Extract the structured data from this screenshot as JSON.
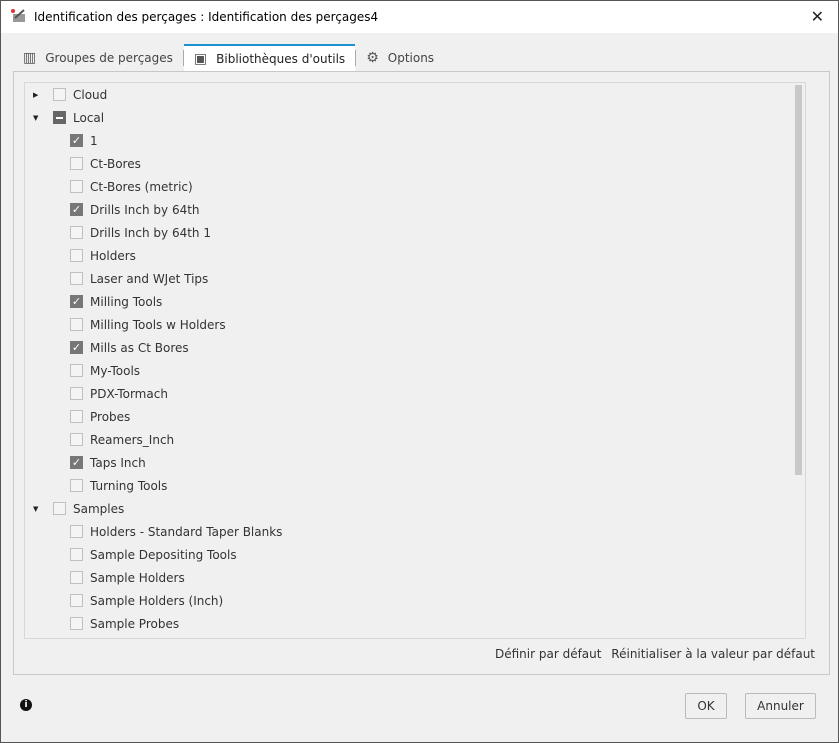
{
  "window": {
    "title": "Identification des perçages : Identification des perçages4",
    "close": "✕"
  },
  "tabs": [
    {
      "label": "Groupes de perçages",
      "icon": "drill-groups-icon"
    },
    {
      "label": "Bibliothèques d'outils",
      "icon": "tool-library-icon",
      "active": true
    },
    {
      "label": "Options",
      "icon": "gear-icon"
    }
  ],
  "tree": [
    {
      "label": "Cloud",
      "level": 0,
      "expander": "collapsed",
      "state": "unchecked"
    },
    {
      "label": "Local",
      "level": 0,
      "expander": "expanded",
      "state": "partial"
    },
    {
      "label": "1",
      "level": 1,
      "state": "checked"
    },
    {
      "label": "Ct-Bores",
      "level": 1,
      "state": "unchecked"
    },
    {
      "label": "Ct-Bores (metric)",
      "level": 1,
      "state": "unchecked"
    },
    {
      "label": "Drills Inch by 64th",
      "level": 1,
      "state": "checked"
    },
    {
      "label": "Drills Inch by 64th 1",
      "level": 1,
      "state": "unchecked"
    },
    {
      "label": "Holders",
      "level": 1,
      "state": "unchecked"
    },
    {
      "label": "Laser and WJet Tips",
      "level": 1,
      "state": "unchecked"
    },
    {
      "label": "Milling Tools",
      "level": 1,
      "state": "checked"
    },
    {
      "label": "Milling Tools w Holders",
      "level": 1,
      "state": "unchecked"
    },
    {
      "label": "Mills as Ct Bores",
      "level": 1,
      "state": "checked"
    },
    {
      "label": "My-Tools",
      "level": 1,
      "state": "unchecked"
    },
    {
      "label": "PDX-Tormach",
      "level": 1,
      "state": "unchecked"
    },
    {
      "label": "Probes",
      "level": 1,
      "state": "unchecked"
    },
    {
      "label": "Reamers_Inch",
      "level": 1,
      "state": "unchecked"
    },
    {
      "label": "Taps Inch",
      "level": 1,
      "state": "checked"
    },
    {
      "label": "Turning Tools",
      "level": 1,
      "state": "unchecked"
    },
    {
      "label": "Samples",
      "level": 0,
      "expander": "expanded",
      "state": "unchecked"
    },
    {
      "label": "Holders - Standard Taper Blanks",
      "level": 1,
      "state": "unchecked"
    },
    {
      "label": "Sample Depositing Tools",
      "level": 1,
      "state": "unchecked"
    },
    {
      "label": "Sample Holders",
      "level": 1,
      "state": "unchecked"
    },
    {
      "label": "Sample Holders (Inch)",
      "level": 1,
      "state": "unchecked"
    },
    {
      "label": "Sample Probes",
      "level": 1,
      "state": "unchecked"
    }
  ],
  "links": {
    "set_default": "Définir par défaut",
    "reset_default": "Réinitialiser à la valeur par défaut"
  },
  "buttons": {
    "ok": "OK",
    "cancel": "Annuler"
  },
  "info_icon": "i"
}
